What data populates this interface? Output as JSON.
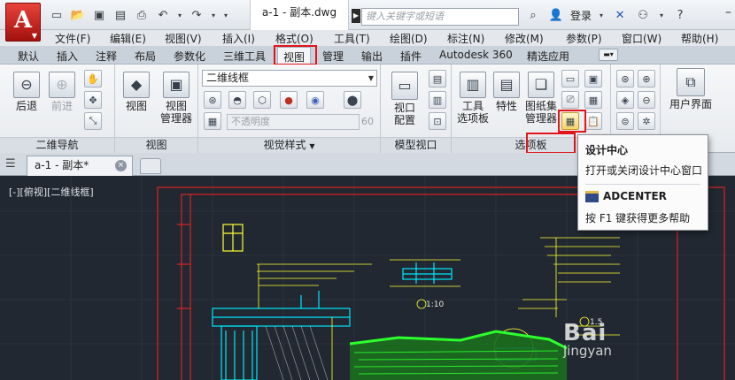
{
  "app": {
    "logo_letter": "A"
  },
  "titlebar": {
    "document_title": "a-1 - 副本.dwg",
    "search_placeholder": "键入关键字或短语",
    "login_label": "登录",
    "help_symbol": "?"
  },
  "menubar": {
    "items": [
      "文件(F)",
      "编辑(E)",
      "视图(V)",
      "插入(I)",
      "格式(O)",
      "工具(T)",
      "绘图(D)",
      "标注(N)",
      "修改(M)",
      "参数(P)",
      "窗口(W)",
      "帮助(H)"
    ]
  },
  "ribbon_tabs": {
    "items": [
      "默认",
      "插入",
      "注释",
      "布局",
      "参数化",
      "三维工具",
      "视图",
      "管理",
      "输出",
      "插件",
      "Autodesk 360",
      "精选应用"
    ],
    "active": "视图"
  },
  "ribbon": {
    "nav": {
      "back": "后退",
      "forward": "前进",
      "title": "二维导航"
    },
    "view": {
      "view_label": "视图",
      "view_manager_line1": "视图",
      "view_manager_line2": "管理器",
      "title": "视图"
    },
    "visual_styles": {
      "style_combo": "二维线框",
      "opacity_label": "不透明度",
      "opacity_value": "60",
      "title": "视觉样式"
    },
    "model_viewports": {
      "config_line1": "视口",
      "config_line2": "配置",
      "title": "模型视口"
    },
    "palettes": {
      "tool_palettes_line1": "工具",
      "tool_palettes_line2": "选项板",
      "properties": "特性",
      "sheet_set_line1": "图纸集",
      "sheet_set_line2": "管理器",
      "title": "选项板"
    },
    "user_interface": {
      "label": "用户界面"
    }
  },
  "drawing_tabs": {
    "active_tab": "a-1 - 副本*",
    "close_symbol": "×"
  },
  "canvas": {
    "viewport_label": "[-][俯视][二维线框]",
    "dimension_label": "1:10",
    "note_label": "1.5"
  },
  "tooltip": {
    "title": "设计中心",
    "description": "打开或关闭设计中心窗口",
    "command": "ADCENTER",
    "help": "按 F1 键获得更多帮助"
  },
  "watermark": {
    "line1": "Bai",
    "line2": "jingyan"
  },
  "colors": {
    "highlight_red": "#e0161c",
    "canvas_bg": "#212831",
    "cad_cyan": "#00e5ff",
    "cad_yellow": "#ffff33",
    "cad_green": "#2cff2c",
    "cad_red": "#ff2020"
  }
}
